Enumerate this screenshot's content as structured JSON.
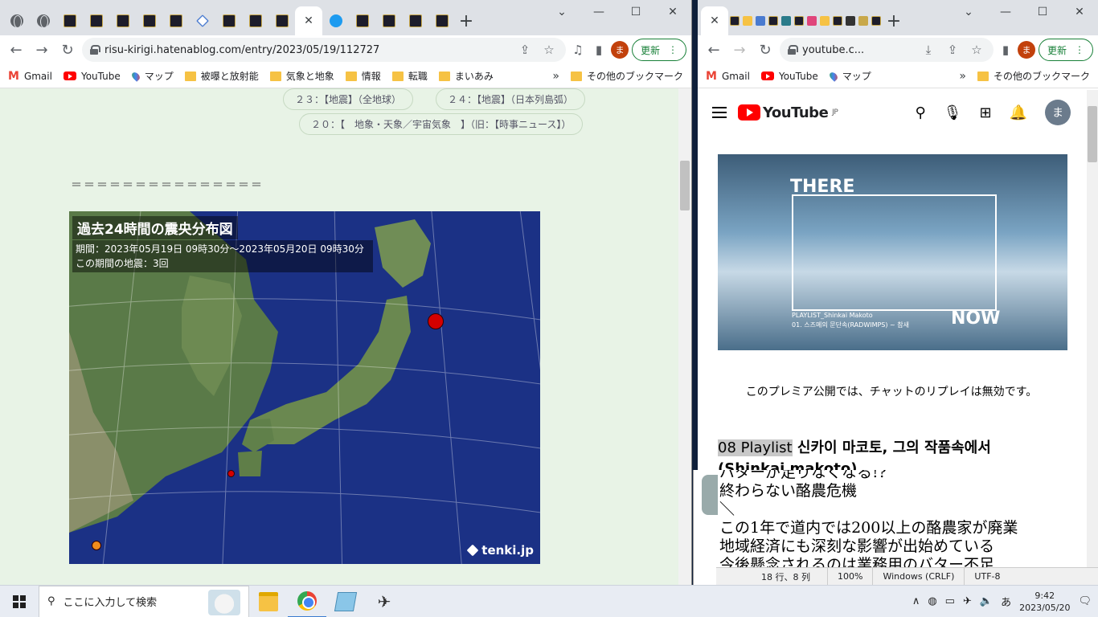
{
  "left_browser": {
    "tabs": [
      {
        "icon": "globe-icon"
      },
      {
        "icon": "globe-icon"
      },
      {
        "icon": "blog-icon"
      },
      {
        "icon": "blog-icon"
      },
      {
        "icon": "blog-icon"
      },
      {
        "icon": "blog-icon"
      },
      {
        "icon": "blog-icon"
      },
      {
        "icon": "cube-icon"
      },
      {
        "icon": "blog-icon"
      },
      {
        "icon": "blog-icon"
      },
      {
        "icon": "blog-icon"
      },
      {
        "icon": "close-icon",
        "active": true
      },
      {
        "icon": "twitter-icon"
      },
      {
        "icon": "blog-icon"
      },
      {
        "icon": "blog-icon"
      },
      {
        "icon": "blog-icon"
      },
      {
        "icon": "blog-icon"
      }
    ],
    "url": "risu-kirigi.hatenablog.com/entry/2023/05/19/112727",
    "update_label": "更新",
    "avatar_letter": "ま",
    "bookmarks": [
      "Gmail",
      "YouTube",
      "マップ",
      "被曝と放射能",
      "気象と地象",
      "情報",
      "転職",
      "まいあみ"
    ],
    "other_bookmarks": "その他のブックマーク",
    "tags": {
      "t23": "２３：【地震】（全地球）",
      "t24": "２４：【地震】（日本列島弧）",
      "t20": "２０：【　地象・天象／宇宙気象　】（旧：【時事ニュース】）"
    },
    "separator": "＝＝＝＝＝＝＝＝＝＝＝＝＝＝＝",
    "map": {
      "title": "過去24時間の震央分布図",
      "period": "期間：2023年05月19日 09時30分～2023年05月20日 09時30分",
      "count": "この期間の地震：3回",
      "logo": "tenki.jp",
      "quake_colors": [
        "#d40000",
        "#d40000",
        "#f08c1e"
      ]
    }
  },
  "right_browser": {
    "url": "youtube.c...",
    "update_label": "更新",
    "avatar_letter": "ま",
    "bookmarks": [
      "Gmail",
      "YouTube",
      "マップ"
    ],
    "other_bookmarks": "その他のブックマーク",
    "yt": {
      "logo_text": "YouTube",
      "region": "JP",
      "avatar_letter": "ま",
      "thumb_there": "THERE",
      "thumb_now": "NOW",
      "thumb_cap1": "PLAYLIST_Shinkai Makoto",
      "thumb_cap2": "01. 스즈메의 문단속(RADWIMPS) ~ 참새",
      "premiere_note": "このプレミア公開では、チャットのリプレイは無効です。",
      "title_hl": "08 Playlist",
      "title_rest": " 신카이 마코토, 그의 작품속에서",
      "title_line2": "(Shinkai makoto)"
    }
  },
  "notepad": {
    "lines": [
      "バターが足りなくなる!?",
      "終わらない酪農危機",
      "＼",
      "この1年で道内では200以上の酪農家が廃業",
      "地域経済にも深刻な影響が出始めている",
      "今後懸念されるのは業務用のバター不足"
    ],
    "status": {
      "pos": "18 行、8 列",
      "zoom": "100%",
      "eol": "Windows (CRLF)",
      "enc": "UTF-8"
    }
  },
  "taskbar": {
    "search_placeholder": "ここに入力して検索",
    "ime": "あ",
    "time": "9:42",
    "date": "2023/05/20"
  }
}
